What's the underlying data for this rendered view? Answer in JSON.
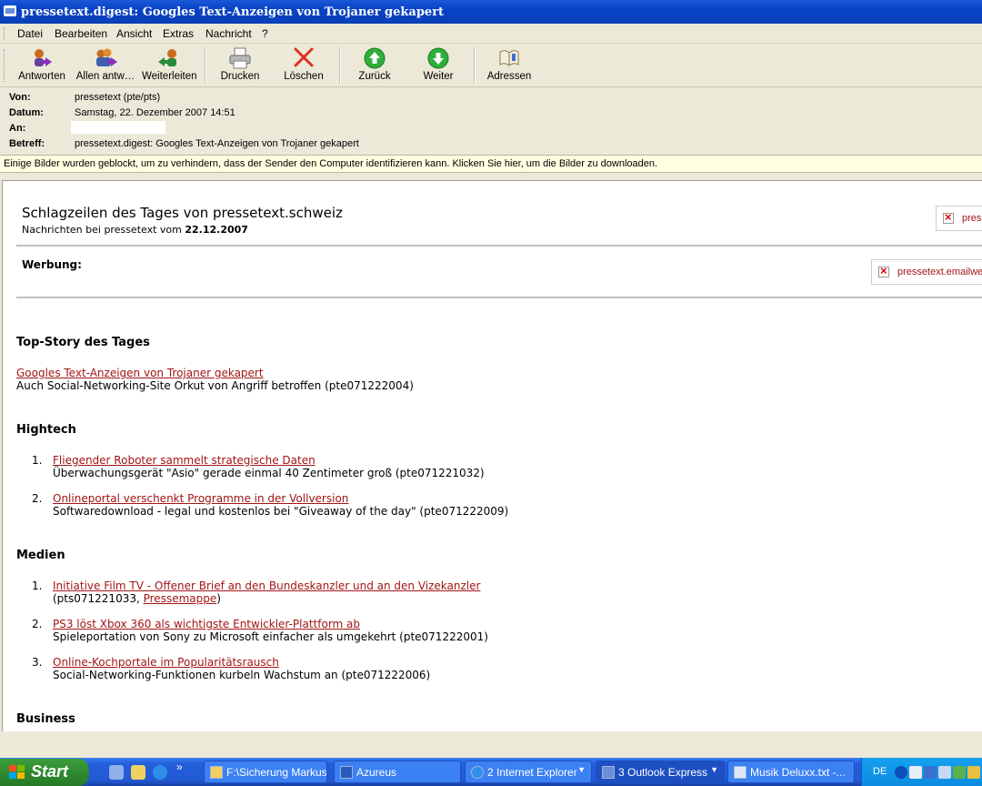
{
  "window": {
    "title": "pressetext.digest: Googles Text-Anzeigen von Trojaner gekapert"
  },
  "menu": [
    "Datei",
    "Bearbeiten",
    "Ansicht",
    "Extras",
    "Nachricht",
    "?"
  ],
  "toolbar": {
    "reply": "Antworten",
    "reply_all": "Allen antw…",
    "forward": "Weiterleiten",
    "print": "Drucken",
    "delete": "Löschen",
    "back": "Zurück",
    "next": "Weiter",
    "addresses": "Adressen"
  },
  "header": {
    "from_label": "Von:",
    "from": "pressetext (pte/pts)",
    "date_label": "Datum:",
    "date": "Samstag, 22. Dezember 2007 14:51",
    "to_label": "An:",
    "subject_label": "Betreff:",
    "subject": "pressetext.digest: Googles Text-Anzeigen von Trojaner gekapert"
  },
  "infobar": "Einige Bilder wurden geblockt, um zu verhindern, dass der Sender den Computer identifizieren kann. Klicken Sie hier, um die Bilder zu downloaden.",
  "content": {
    "title": "Schlagzeilen des Tages von pressetext.schweiz",
    "subtitle_prefix": "Nachrichten bei pressetext vom ",
    "subtitle_date": "22.12.2007",
    "image1_alt": "pressetext",
    "werbung": "Werbung:",
    "image2_alt": "pressetext.emailwerbung",
    "top_story": {
      "heading": "Top-Story des Tages",
      "link": "Googles Text-Anzeigen von Trojaner gekapert",
      "text": "Auch Social-Networking-Site Orkut von Angriff betroffen (pte071222004)"
    },
    "hightech": {
      "heading": "Hightech",
      "items": [
        {
          "num": "1.",
          "link": "Fliegender Roboter sammelt strategische Daten",
          "text": "Überwachungsgerät \"Asio\" gerade einmal 40 Zentimeter groß (pte071221032)"
        },
        {
          "num": "2.",
          "link": "Onlineportal verschenkt Programme in der Vollversion",
          "text": "Softwaredownload - legal und kostenlos bei \"Giveaway of the day\" (pte071222009)"
        }
      ]
    },
    "medien": {
      "heading": "Medien",
      "items": [
        {
          "num": "1.",
          "link": "Initiative Film TV - Offener Brief an den Bundeskanzler und an den Vizekanzler",
          "text_prefix": "(pts071221033, ",
          "text_link": "Pressemappe",
          "text_suffix": ")"
        },
        {
          "num": "2.",
          "link": "PS3 löst Xbox 360 als wichtigste Entwickler-Plattform ab",
          "text": "Spieleportation von Sony zu Microsoft einfacher als umgekehrt (pte071222001)"
        },
        {
          "num": "3.",
          "link": "Online-Kochportale im Popularitätsrausch",
          "text": "Social-Networking-Funktionen kurbeln Wachstum an (pte071222006)"
        }
      ]
    },
    "business": {
      "heading": "Business"
    }
  },
  "taskbar": {
    "start": "Start",
    "more": "»",
    "tasks": [
      {
        "label": "F:\\Sicherung Markus"
      },
      {
        "label": "Azureus"
      },
      {
        "label": "2 Internet Explorer"
      },
      {
        "label": "3 Outlook Express"
      },
      {
        "label": "Musik Deluxx.txt -..."
      }
    ],
    "tray_lang": "DE"
  }
}
